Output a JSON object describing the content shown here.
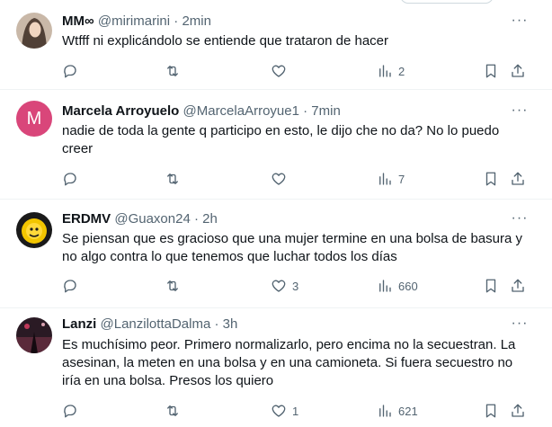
{
  "tweets": [
    {
      "name": "MM∞",
      "handle": "@mirimarini",
      "time": "2min",
      "text": "Wtfff ni explicándolo se entiende que trataron de hacer",
      "likes": "",
      "retweets": "",
      "views": "2",
      "avatar_kind": "photo-woman"
    },
    {
      "name": "Marcela Arroyuelo",
      "handle": "@MarcelaArroyue1",
      "time": "7min",
      "text": "nadie de toda la gente q participo en esto, le dijo che no da? No lo puedo creer",
      "likes": "",
      "retweets": "",
      "views": "7",
      "avatar_letter": "M",
      "avatar_color": "#d9467a"
    },
    {
      "name": "ERDMV",
      "handle": "@Guaxon24",
      "time": "2h",
      "text": "Se piensan que es gracioso que una mujer termine en una bolsa de basura y no algo contra lo que tenemos que luchar todos los días",
      "likes": "3",
      "retweets": "",
      "views": "660",
      "avatar_kind": "yellow-cartoon"
    },
    {
      "name": "Lanzi",
      "handle": "@LanzilottaDalma",
      "time": "3h",
      "text": "Es muchísimo peor. Primero normalizarlo, pero encima no la secuestran. La asesinan, la meten en una bolsa y en una camioneta. Si fuera secuestro no iría en una bolsa. Presos los quiero",
      "likes": "1",
      "retweets": "",
      "views": "621",
      "avatar_kind": "dark-photo"
    }
  ],
  "dot": "·",
  "more": "···"
}
